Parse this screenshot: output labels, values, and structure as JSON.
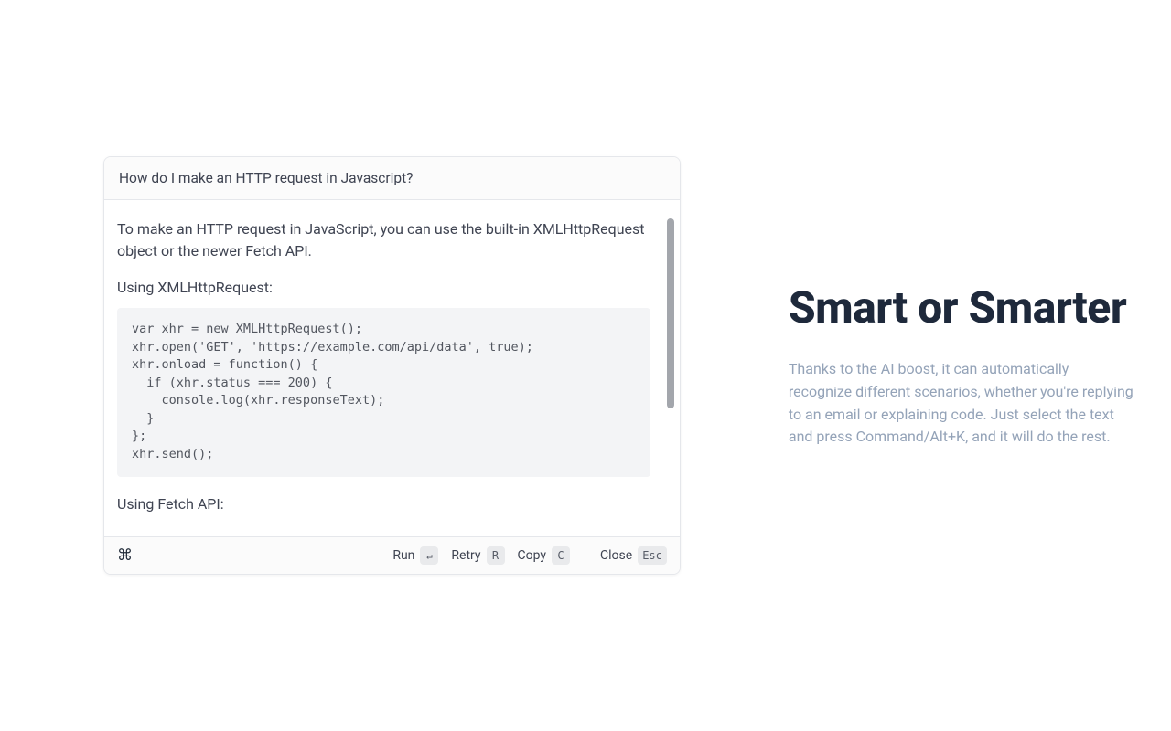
{
  "dialog": {
    "title": "How do I make an HTTP request in Javascript?",
    "intro": "To make an HTTP request in JavaScript, you can use the built-in XMLHttpRequest object or the newer Fetch API.",
    "section1_label": "Using XMLHttpRequest:",
    "code1": "var xhr = new XMLHttpRequest();\nxhr.open('GET', 'https://example.com/api/data', true);\nxhr.onload = function() {\n  if (xhr.status === 200) {\n    console.log(xhr.responseText);\n  }\n};\nxhr.send();",
    "section2_label": "Using Fetch API:"
  },
  "footer": {
    "cmd_glyph": "⌘",
    "run_label": "Run",
    "run_key": "↵",
    "retry_label": "Retry",
    "retry_key": "R",
    "copy_label": "Copy",
    "copy_key": "C",
    "close_label": "Close",
    "close_key": "Esc"
  },
  "right": {
    "headline": "Smart or Smarter",
    "description": "Thanks to the AI boost, it can automatically recognize different scenarios, whether you're replying to an email or explaining code. Just select the text and press Command/Alt+K, and it will do the rest."
  }
}
